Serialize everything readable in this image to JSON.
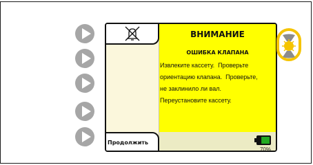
{
  "left_buttons": [
    {
      "name": "play-button-1",
      "icon": "play-icon"
    },
    {
      "name": "play-button-2",
      "icon": "play-icon"
    },
    {
      "name": "play-button-3",
      "icon": "play-icon"
    },
    {
      "name": "play-button-4",
      "icon": "play-icon"
    },
    {
      "name": "play-button-5",
      "icon": "play-icon"
    }
  ],
  "alarm": {
    "icon": "alarm-silenced-icon"
  },
  "warning": {
    "title": "ВНИМАНИЕ",
    "subtitle": "ОШИБКА КЛАПАНА",
    "lines": [
      "Извлеките кассету.  Проверьте",
      "ориентацию клапана.  Проверьте,",
      "не заклинило ли вал.",
      "Переустановите кассету."
    ],
    "background_color": "#ffff00"
  },
  "continue_button": {
    "label": "Продолжить"
  },
  "battery": {
    "percent_label": "70%",
    "level": 0.7,
    "icon": "battery-icon",
    "color": "#22aa22"
  },
  "side_indicator": {
    "icon": "pump-indicator-icon",
    "highlight_color": "#f5c400"
  }
}
